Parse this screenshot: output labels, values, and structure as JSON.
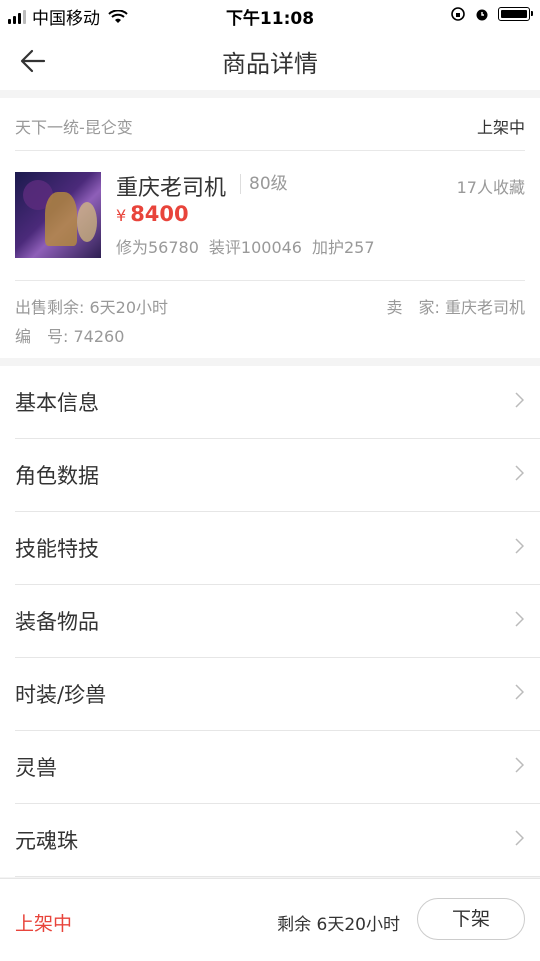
{
  "statusbar": {
    "carrier": "中国移动",
    "time": "下午11:08"
  },
  "nav": {
    "title": "商品详情",
    "back_icon": "arrow-left-icon"
  },
  "product": {
    "server": "天下一统-昆仑变",
    "status": "上架中",
    "name": "重庆老司机",
    "level": "80级",
    "favorites": "17人收藏",
    "price_symbol": "¥",
    "price": "8400",
    "stats": [
      "修为56780",
      "装评100046",
      "加护257"
    ],
    "remaining": "出售剩余: 6天20小时",
    "seller": "卖　家: 重庆老司机",
    "serial": "编　号: 74260"
  },
  "menu": [
    {
      "label": "基本信息"
    },
    {
      "label": "角色数据"
    },
    {
      "label": "技能特技"
    },
    {
      "label": "装备物品"
    },
    {
      "label": "时装/珍兽"
    },
    {
      "label": "灵兽"
    },
    {
      "label": "元魂珠"
    }
  ],
  "footer": {
    "status": "上架中",
    "remaining": "剩余 6天20小时",
    "button": "下架"
  },
  "colors": {
    "accent": "#e8443b"
  }
}
